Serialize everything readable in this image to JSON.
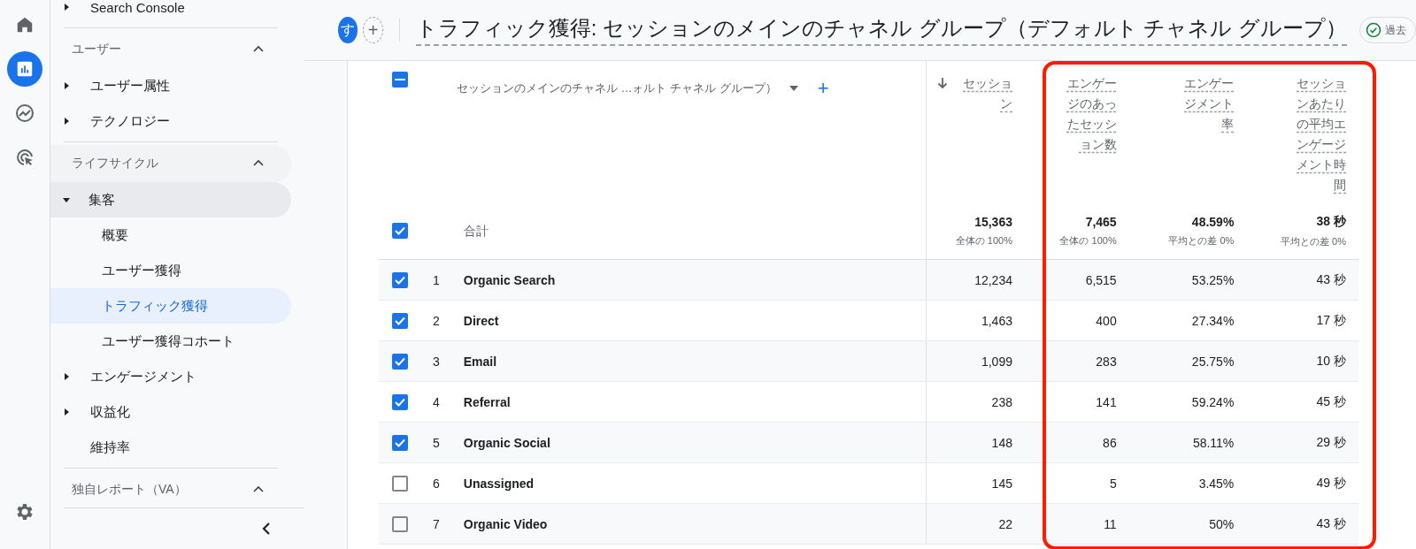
{
  "rail": [
    {
      "kind": "home",
      "selected": false
    },
    {
      "kind": "reports",
      "selected": true
    },
    {
      "kind": "explore",
      "selected": false
    },
    {
      "kind": "advertising",
      "selected": false
    }
  ],
  "sidebar": {
    "top_item": {
      "label": "Search Console",
      "expanded": false
    },
    "sections": [
      {
        "title": "ユーザー",
        "expanded": true,
        "items": [
          {
            "label": "ユーザー属性",
            "expanded": false
          },
          {
            "label": "テクノロジー",
            "expanded": false
          }
        ]
      },
      {
        "title": "ライフサイクル",
        "expanded": true,
        "items": [
          {
            "label": "集客",
            "expanded": true,
            "children": [
              {
                "label": "概要",
                "selected": false
              },
              {
                "label": "ユーザー獲得",
                "selected": false
              },
              {
                "label": "トラフィック獲得",
                "selected": true
              },
              {
                "label": "ユーザー獲得コホート",
                "selected": false
              }
            ]
          },
          {
            "label": "エンゲージメント",
            "expanded": false
          },
          {
            "label": "収益化",
            "expanded": false
          },
          {
            "label": "維持率",
            "selected": false
          }
        ]
      },
      {
        "title": "独自レポート（VA）",
        "expanded": true
      }
    ]
  },
  "header": {
    "avatar": "す",
    "add_button": "+",
    "title": "トラフィック獲得: セッションのメインのチャネル グループ（デフォルト チャネル グループ）",
    "chip": "過去"
  },
  "table": {
    "header_checkbox_partial": true,
    "highlight_frame": true,
    "dimension": {
      "label": "セッションのメインのチャネル …ォルト チャネル グループ）",
      "add": "+"
    },
    "columns": [
      {
        "label": "セッション",
        "sorted": true
      },
      {
        "label": "エンゲージのあったセッション数",
        "sorted": false
      },
      {
        "label": "エンゲージメント率",
        "sorted": false
      },
      {
        "label": "セッションあたりの平均エンゲージメント時間",
        "sorted": false
      }
    ],
    "total": {
      "checked": true,
      "label": "合計",
      "values": [
        {
          "value": "15,363",
          "sub": "全体の 100%"
        },
        {
          "value": "7,465",
          "sub": "全体の 100%"
        },
        {
          "value": "48.59%",
          "sub": "平均との差 0%"
        },
        {
          "value": "38 秒",
          "sub": "平均との差 0%"
        }
      ]
    },
    "rows": [
      {
        "checked": true,
        "index": "1",
        "name": "Organic Search",
        "values": [
          "12,234",
          "6,515",
          "53.25%",
          "43 秒"
        ]
      },
      {
        "checked": true,
        "index": "2",
        "name": "Direct",
        "values": [
          "1,463",
          "400",
          "27.34%",
          "17 秒"
        ]
      },
      {
        "checked": true,
        "index": "3",
        "name": "Email",
        "values": [
          "1,099",
          "283",
          "25.75%",
          "10 秒"
        ]
      },
      {
        "checked": true,
        "index": "4",
        "name": "Referral",
        "values": [
          "238",
          "141",
          "59.24%",
          "45 秒"
        ]
      },
      {
        "checked": true,
        "index": "5",
        "name": "Organic Social",
        "values": [
          "148",
          "86",
          "58.11%",
          "29 秒"
        ]
      },
      {
        "checked": false,
        "index": "6",
        "name": "Unassigned",
        "values": [
          "145",
          "5",
          "3.45%",
          "49 秒"
        ]
      },
      {
        "checked": false,
        "index": "7",
        "name": "Organic Video",
        "values": [
          "22",
          "11",
          "50%",
          "43 秒"
        ]
      }
    ]
  }
}
